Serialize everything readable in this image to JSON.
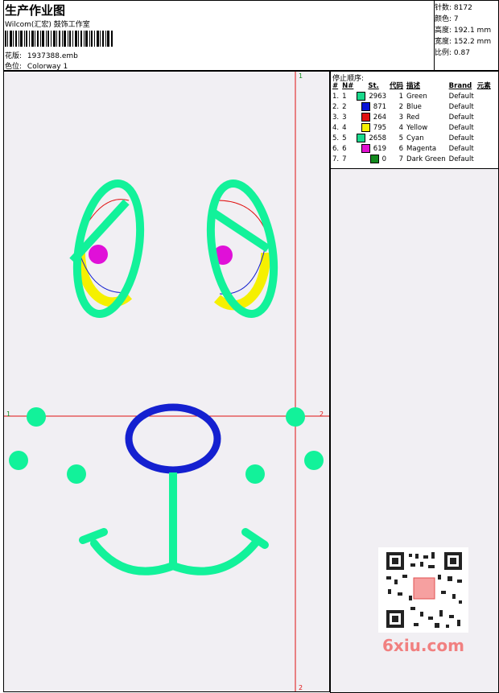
{
  "header": {
    "title": "生产作业图",
    "subtitle": "Wilcom(汇宏) 鼓饰工作室",
    "design_label": "花版:",
    "design_file": "1937388.emb",
    "colorway_label": "色位:",
    "colorway": "Colorway 1"
  },
  "stats": {
    "stitches_label": "针数:",
    "stitches": "8172",
    "colors_label": "颜色:",
    "colors": "7",
    "height_label": "高度:",
    "height": "192.1 mm",
    "width_label": "宽度:",
    "width": "152.2 mm",
    "ratio_label": "比例:",
    "ratio": "0.87"
  },
  "stop_sequence": {
    "title": "停止顺序:",
    "columns": [
      "#",
      "N#",
      "St.",
      "代码",
      "描述",
      "Brand",
      "元素"
    ],
    "rows": [
      {
        "idx": "1.",
        "n": "1",
        "color": "#1ad98c",
        "st": "2963",
        "code": "1",
        "desc": "Green",
        "brand": "Default"
      },
      {
        "idx": "2.",
        "n": "2",
        "color": "#0a14d6",
        "st": "871",
        "code": "2",
        "desc": "Blue",
        "brand": "Default"
      },
      {
        "idx": "3.",
        "n": "3",
        "color": "#e01010",
        "st": "264",
        "code": "3",
        "desc": "Red",
        "brand": "Default"
      },
      {
        "idx": "4.",
        "n": "4",
        "color": "#f5f000",
        "st": "795",
        "code": "4",
        "desc": "Yellow",
        "brand": "Default"
      },
      {
        "idx": "5.",
        "n": "5",
        "color": "#1ad98c",
        "st": "2658",
        "code": "5",
        "desc": "Cyan",
        "brand": "Default"
      },
      {
        "idx": "6.",
        "n": "6",
        "color": "#e010d0",
        "st": "619",
        "code": "6",
        "desc": "Magenta",
        "brand": "Default"
      },
      {
        "idx": "7.",
        "n": "7",
        "color": "#138a1e",
        "st": "0",
        "code": "7",
        "desc": "Dark Green",
        "brand": "Default"
      }
    ]
  },
  "guides": {
    "v_top": "1",
    "v_bottom": "2",
    "h_left": "1",
    "h_right": "2"
  },
  "watermark": "6xiu.com",
  "colors": {
    "green": "#12f29a",
    "blue": "#1420d0",
    "red": "#e01010",
    "yellow": "#f5f000",
    "magenta": "#e010d8",
    "guide": "#e01010"
  }
}
